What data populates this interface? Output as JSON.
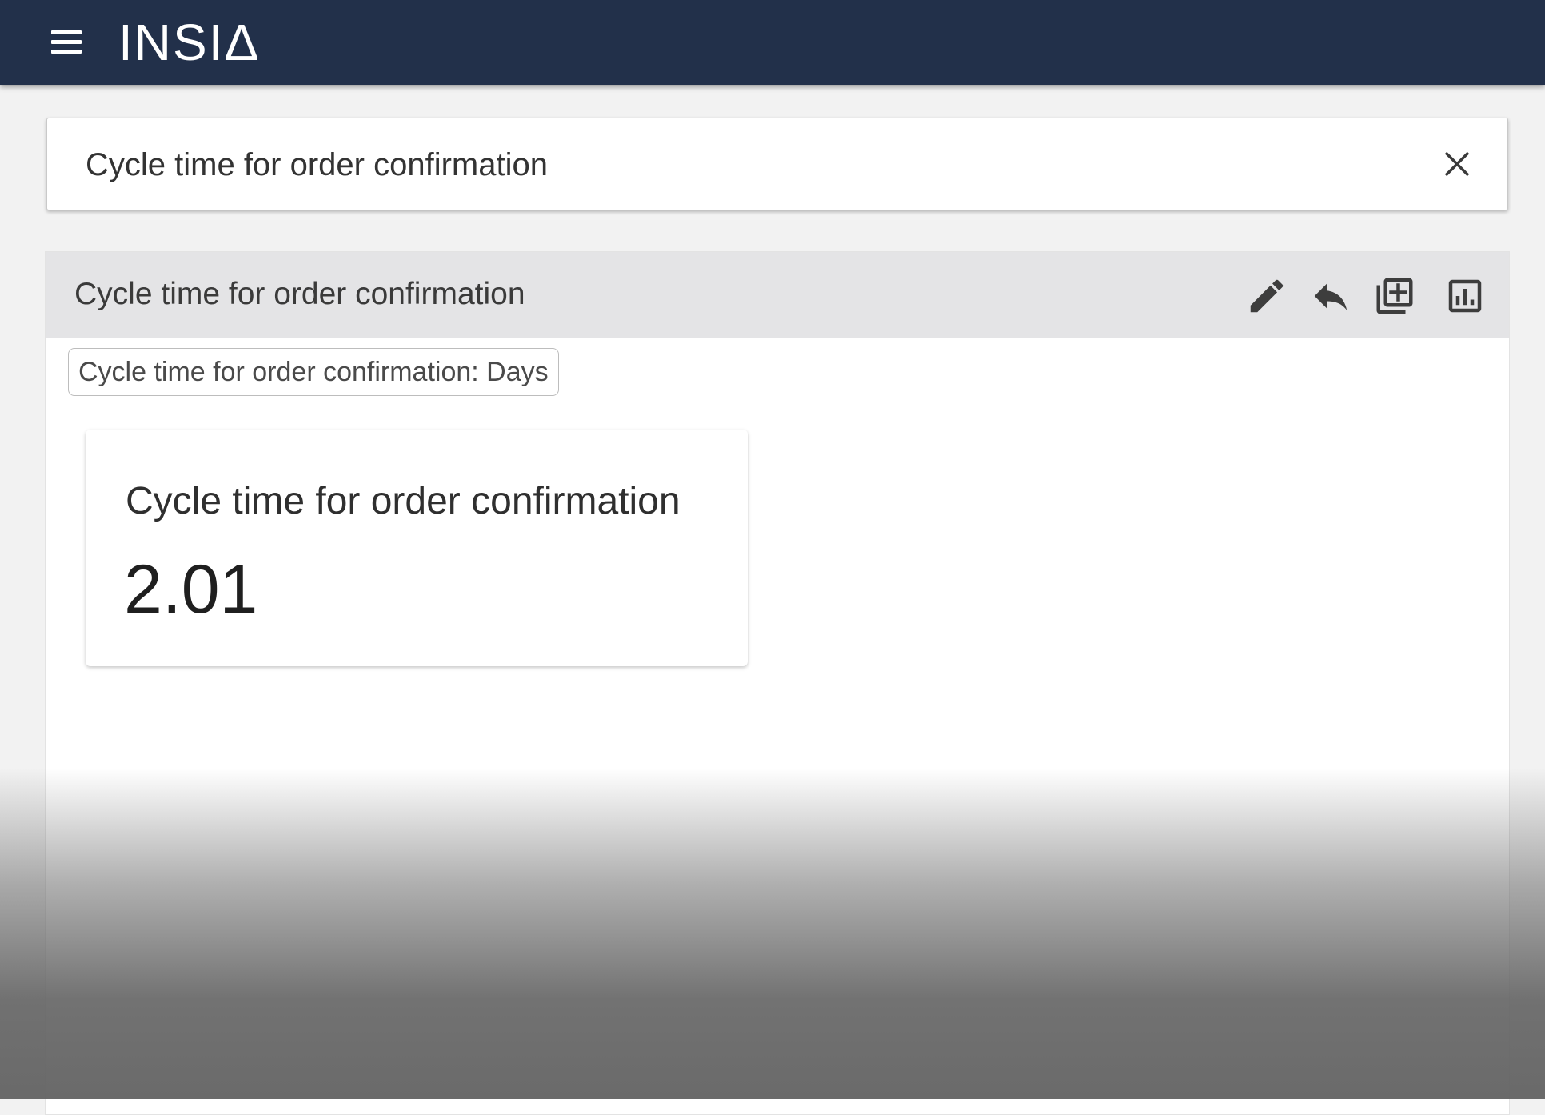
{
  "app": {
    "logo_text": "INSIΔ",
    "brand_color": "#22304a"
  },
  "search": {
    "value": "Cycle time for order confirmation"
  },
  "result_panel": {
    "title": "Cycle time for order confirmation",
    "filter_chip": "Cycle time for order confirmation: Days",
    "tools": [
      "edit-icon",
      "reply-icon",
      "add-to-library-icon",
      "bar-chart-icon"
    ]
  },
  "kpi": {
    "title": "Cycle time for order confirmation",
    "value": "2.01"
  }
}
